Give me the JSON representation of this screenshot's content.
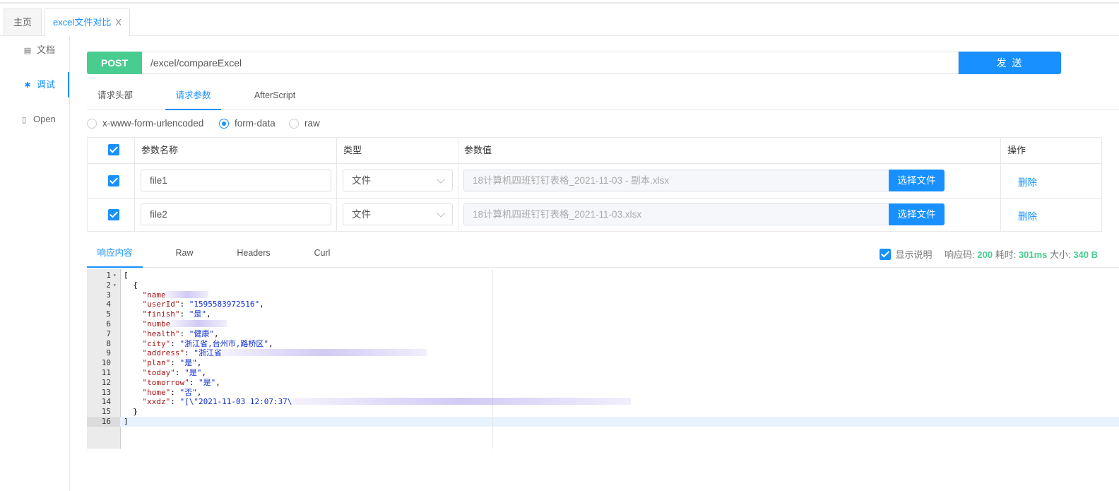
{
  "tabs": [
    {
      "label": "主页"
    },
    {
      "label": "excel文件对比",
      "close": "X"
    }
  ],
  "sidebar": {
    "items": [
      {
        "label": "文档",
        "icon": "document-icon"
      },
      {
        "label": "调试",
        "icon": "bug-icon"
      },
      {
        "label": "Open",
        "icon": "file-icon"
      }
    ]
  },
  "request": {
    "method": "POST",
    "url": "/excel/compareExcel",
    "send_label": "发 送"
  },
  "request_tabs": [
    "请求头部",
    "请求参数",
    "AfterScript"
  ],
  "body_types": [
    "x-www-form-urlencoded",
    "form-data",
    "raw"
  ],
  "params_table": {
    "headers": {
      "name": "参数名称",
      "type": "类型",
      "value": "参数值",
      "action": "操作"
    },
    "rows": [
      {
        "name": "file1",
        "type": "文件",
        "value": "18计算机四班钉钉表格_2021-11-03 - 副本.xlsx",
        "button": "选择文件",
        "delete": "删除"
      },
      {
        "name": "file2",
        "type": "文件",
        "value": "18计算机四班钉钉表格_2021-11-03.xlsx",
        "button": "选择文件",
        "delete": "删除"
      }
    ]
  },
  "response_tabs": [
    "响应内容",
    "Raw",
    "Headers",
    "Curl"
  ],
  "response_info": {
    "show_desc": "显示说明",
    "code_label": "响应码:",
    "code": "200",
    "time_label": "耗时:",
    "time": "301ms",
    "size_label": "大小:",
    "size": "340 B"
  },
  "code_lines": [
    {
      "n": "1",
      "fold": "▾",
      "parts": [
        [
          "p",
          "["
        ]
      ]
    },
    {
      "n": "2",
      "fold": "▾",
      "parts": [
        [
          "p",
          "  {"
        ]
      ]
    },
    {
      "n": "3",
      "fold": "",
      "parts": [
        [
          "k",
          "    \"name"
        ]
      ]
    },
    {
      "n": "4",
      "fold": "",
      "parts": [
        [
          "k",
          "    \"userId\""
        ],
        [
          "p",
          ": "
        ],
        [
          "s",
          "\"1595583972516\""
        ],
        [
          "p",
          ","
        ]
      ]
    },
    {
      "n": "5",
      "fold": "",
      "parts": [
        [
          "k",
          "    \"finish\""
        ],
        [
          "p",
          ": "
        ],
        [
          "s",
          "\"是\""
        ],
        [
          "p",
          ","
        ]
      ]
    },
    {
      "n": "6",
      "fold": "",
      "parts": [
        [
          "k",
          "    \"numbe"
        ]
      ]
    },
    {
      "n": "7",
      "fold": "",
      "parts": [
        [
          "k",
          "    \"health\""
        ],
        [
          "p",
          ": "
        ],
        [
          "s",
          "\"健康\""
        ],
        [
          "p",
          ","
        ]
      ]
    },
    {
      "n": "8",
      "fold": "",
      "parts": [
        [
          "k",
          "    \"city\""
        ],
        [
          "p",
          ": "
        ],
        [
          "s",
          "\"浙江省,台州市,路桥区\""
        ],
        [
          "p",
          ","
        ]
      ]
    },
    {
      "n": "9",
      "fold": "",
      "parts": [
        [
          "k",
          "    \"address\""
        ],
        [
          "p",
          ": "
        ],
        [
          "s",
          "\"浙江省"
        ]
      ]
    },
    {
      "n": "10",
      "fold": "",
      "parts": [
        [
          "k",
          "    \"plan\""
        ],
        [
          "p",
          ": "
        ],
        [
          "s",
          "\"是\""
        ],
        [
          "p",
          ","
        ]
      ]
    },
    {
      "n": "11",
      "fold": "",
      "parts": [
        [
          "k",
          "    \"today\""
        ],
        [
          "p",
          ": "
        ],
        [
          "s",
          "\"是\""
        ],
        [
          "p",
          ","
        ]
      ]
    },
    {
      "n": "12",
      "fold": "",
      "parts": [
        [
          "k",
          "    \"tomorrow\""
        ],
        [
          "p",
          ": "
        ],
        [
          "s",
          "\"是\""
        ],
        [
          "p",
          ","
        ]
      ]
    },
    {
      "n": "13",
      "fold": "",
      "parts": [
        [
          "k",
          "    \"home\""
        ],
        [
          "p",
          ": "
        ],
        [
          "s",
          "\"否\""
        ],
        [
          "p",
          ","
        ]
      ]
    },
    {
      "n": "14",
      "fold": "",
      "parts": [
        [
          "k",
          "    \"xxdz\""
        ],
        [
          "p",
          ": "
        ],
        [
          "s",
          "\"[\\\"2021-11-03 12:07:37\\"
        ]
      ]
    },
    {
      "n": "15",
      "fold": "",
      "parts": [
        [
          "p",
          "  }"
        ]
      ]
    },
    {
      "n": "16",
      "fold": "",
      "parts": [
        [
          "p",
          "]"
        ]
      ]
    }
  ],
  "colors": {
    "accent": "#1890ff",
    "post": "#49cc90"
  }
}
